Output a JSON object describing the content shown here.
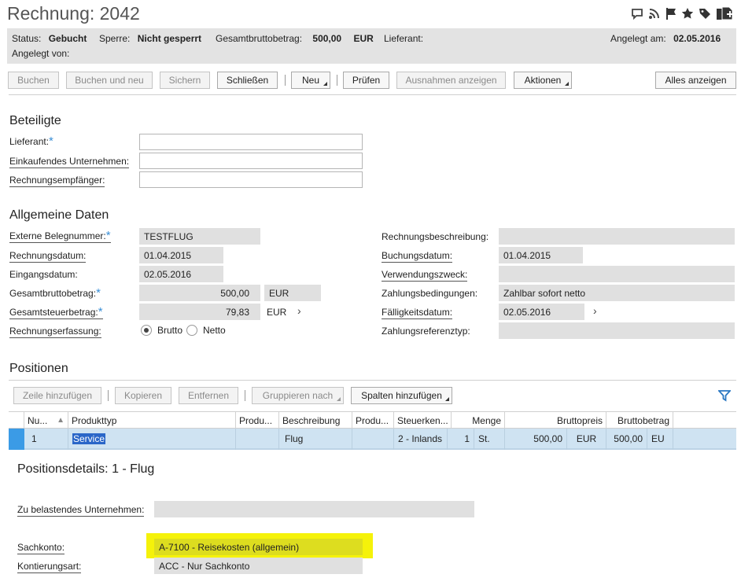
{
  "title": "Rechnung: 2042",
  "top_icons": [
    "chat-icon",
    "rss-icon",
    "flag-icon",
    "star-icon",
    "tag-icon",
    "add-document-icon"
  ],
  "status": {
    "status_label": "Status:",
    "status_value": "Gebucht",
    "sperre_label": "Sperre:",
    "sperre_value": "Nicht gesperrt",
    "gesamt_label": "Gesamtbruttobetrag:",
    "gesamt_value": "500,00",
    "gesamt_currency": "EUR",
    "lieferant_label": "Lieferant:",
    "angelegt_am_label": "Angelegt am:",
    "angelegt_am_value": "02.05.2016",
    "angelegt_von_label": "Angelegt von:"
  },
  "toolbar": {
    "buchen": "Buchen",
    "buchen_neu": "Buchen und neu",
    "sichern": "Sichern",
    "schliessen": "Schließen",
    "neu": "Neu",
    "pruefen": "Prüfen",
    "ausnahmen": "Ausnahmen anzeigen",
    "aktionen": "Aktionen",
    "alles": "Alles anzeigen"
  },
  "beteiligte": {
    "heading": "Beteiligte",
    "lieferant": "Lieferant:",
    "einkaufendes": "Einkaufendes Unternehmen:",
    "empfaenger": "Rechnungsempfänger:"
  },
  "allgemein": {
    "heading": "Allgemeine Daten",
    "externe_label": "Externe Belegnummer:",
    "externe_value": "TESTFLUG",
    "rdatum_label": "Rechnungsdatum:",
    "rdatum_value": "01.04.2015",
    "edatum_label": "Eingangsdatum:",
    "edatum_value": "02.05.2016",
    "brutto_label": "Gesamtbruttobetrag:",
    "brutto_value": "500,00",
    "brutto_currency": "EUR",
    "steuer_label": "Gesamtsteuerbetrag:",
    "steuer_value": "79,83",
    "steuer_currency": "EUR",
    "erfassung_label": "Rechnungserfassung:",
    "opt_brutto": "Brutto",
    "opt_netto": "Netto",
    "beschreibung_label": "Rechnungsbeschreibung:",
    "buchungsdatum_label": "Buchungsdatum:",
    "buchungsdatum_value": "01.04.2015",
    "verwendung_label": "Verwendungszweck:",
    "zahlungsbed_label": "Zahlungsbedingungen:",
    "zahlungsbed_value": "Zahlbar sofort netto",
    "faellig_label": "Fälligkeitsdatum:",
    "faellig_value": "02.05.2016",
    "zahlref_label": "Zahlungsreferenztyp:"
  },
  "positionen": {
    "heading": "Positionen",
    "zeile": "Zeile hinzufügen",
    "kopieren": "Kopieren",
    "entfernen": "Entfernen",
    "gruppieren": "Gruppieren nach",
    "spalten": "Spalten hinzufügen",
    "columns": [
      "Nu...",
      "Produkttyp",
      "Produ...",
      "Beschreibung",
      "Produ...",
      "Steuerken...",
      "Menge",
      "Bruttopreis",
      "Bruttobetrag"
    ],
    "row": {
      "nr": "1",
      "typ": "Service",
      "beschreibung": "Flug",
      "steuer": "2 - Inlands",
      "menge": "1",
      "einheit": "St.",
      "preis": "500,00",
      "preis_cur": "EUR",
      "betrag": "500,00",
      "betrag_cur": "EU"
    }
  },
  "details": {
    "heading": "Positionsdetails: 1 - Flug",
    "zu_belastend_label": "Zu belastendes Unternehmen:",
    "sachkonto_label": "Sachkonto:",
    "sachkonto_value": "A-7100 - Reisekosten (allgemein)",
    "kontierung_label": "Kontierungsart:",
    "kontierung_value": "ACC - Nur Sachkonto"
  },
  "colors": {
    "highlight": "#f5f20a",
    "selection": "#2a66c8",
    "row_bg": "#cfe3f2",
    "required": "#3b8fd6"
  }
}
